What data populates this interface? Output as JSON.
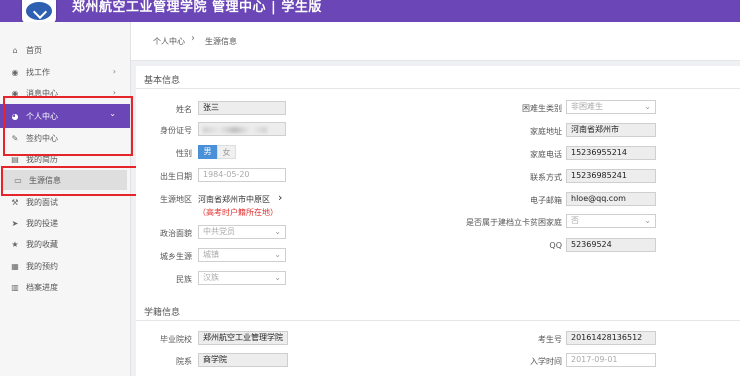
{
  "header": {
    "title": "郑州航空工业管理学院 管理中心 | 学生版"
  },
  "sidebar": {
    "items": [
      {
        "label": "首页",
        "icon": "home-icon",
        "glyph": "⌂"
      },
      {
        "label": "找工作",
        "icon": "eye-icon",
        "glyph": "◉",
        "arrow": "›"
      },
      {
        "label": "消息中心",
        "icon": "eye-icon",
        "glyph": "◉",
        "arrow": "›"
      },
      {
        "label": "个人中心",
        "icon": "user-circle-icon",
        "glyph": "◕",
        "arrow": "⌄"
      },
      {
        "label": "签约中心",
        "icon": "pencil-icon",
        "glyph": "✎"
      },
      {
        "label": "我的简历",
        "icon": "document-icon",
        "glyph": "▤"
      },
      {
        "label": "生源信息",
        "icon": "id-card-icon",
        "glyph": "▭"
      },
      {
        "label": "我的面试",
        "icon": "gavel-icon",
        "glyph": "⚒"
      },
      {
        "label": "我的投递",
        "icon": "send-icon",
        "glyph": "➤"
      },
      {
        "label": "我的收藏",
        "icon": "star-icon",
        "glyph": "★"
      },
      {
        "label": "我的预约",
        "icon": "calendar-icon",
        "glyph": "▦"
      },
      {
        "label": "档案进度",
        "icon": "bar-chart-icon",
        "glyph": "▥"
      }
    ]
  },
  "breadcrumb": {
    "parent": "个人中心",
    "sep": "›",
    "current": "生源信息"
  },
  "basic": {
    "title": "基本信息",
    "name_label": "姓名",
    "name": "张三",
    "id_label": "身份证号",
    "gender_label": "性别",
    "male": "男",
    "female": "女",
    "birth_label": "出生日期",
    "birth": "1984-05-20",
    "origin_label": "生源地区",
    "origin": "河南省郑州市中原区",
    "origin_arrow": "›",
    "origin_note": "（高考时户籍所在地）",
    "politics_label": "政治面貌",
    "politics": "中共党员",
    "urban_label": "城乡生源",
    "urban": "城镇",
    "ethnic_label": "民族",
    "ethnic": "汉族",
    "hardship_label": "困难生类别",
    "hardship": "非困难生",
    "address_label": "家庭地址",
    "address": "河南省郑州市",
    "phone_label": "家庭电话",
    "phone": "15236955214",
    "contact_label": "联系方式",
    "contact": "15236985241",
    "email_label": "电子邮箱",
    "email": "hloe@qq.com",
    "poverty_label": "是否属于建档立卡贫困家庭",
    "poverty": "否",
    "qq_label": "QQ",
    "qq": "52369524"
  },
  "school": {
    "title": "学籍信息",
    "grad_school_label": "毕业院校",
    "grad_school": "郑州航空工业管理学院",
    "dept_label": "院系",
    "dept": "商学院",
    "exam_no_label": "考生号",
    "exam_no": "20161428136512",
    "enroll_label": "入学时间",
    "enroll": "2017-09-01"
  },
  "colors": {
    "header": "#6a46b6",
    "active_menu": "#6a46b6",
    "highlight": "#e5252a",
    "toggle_on": "#4a90d9"
  }
}
